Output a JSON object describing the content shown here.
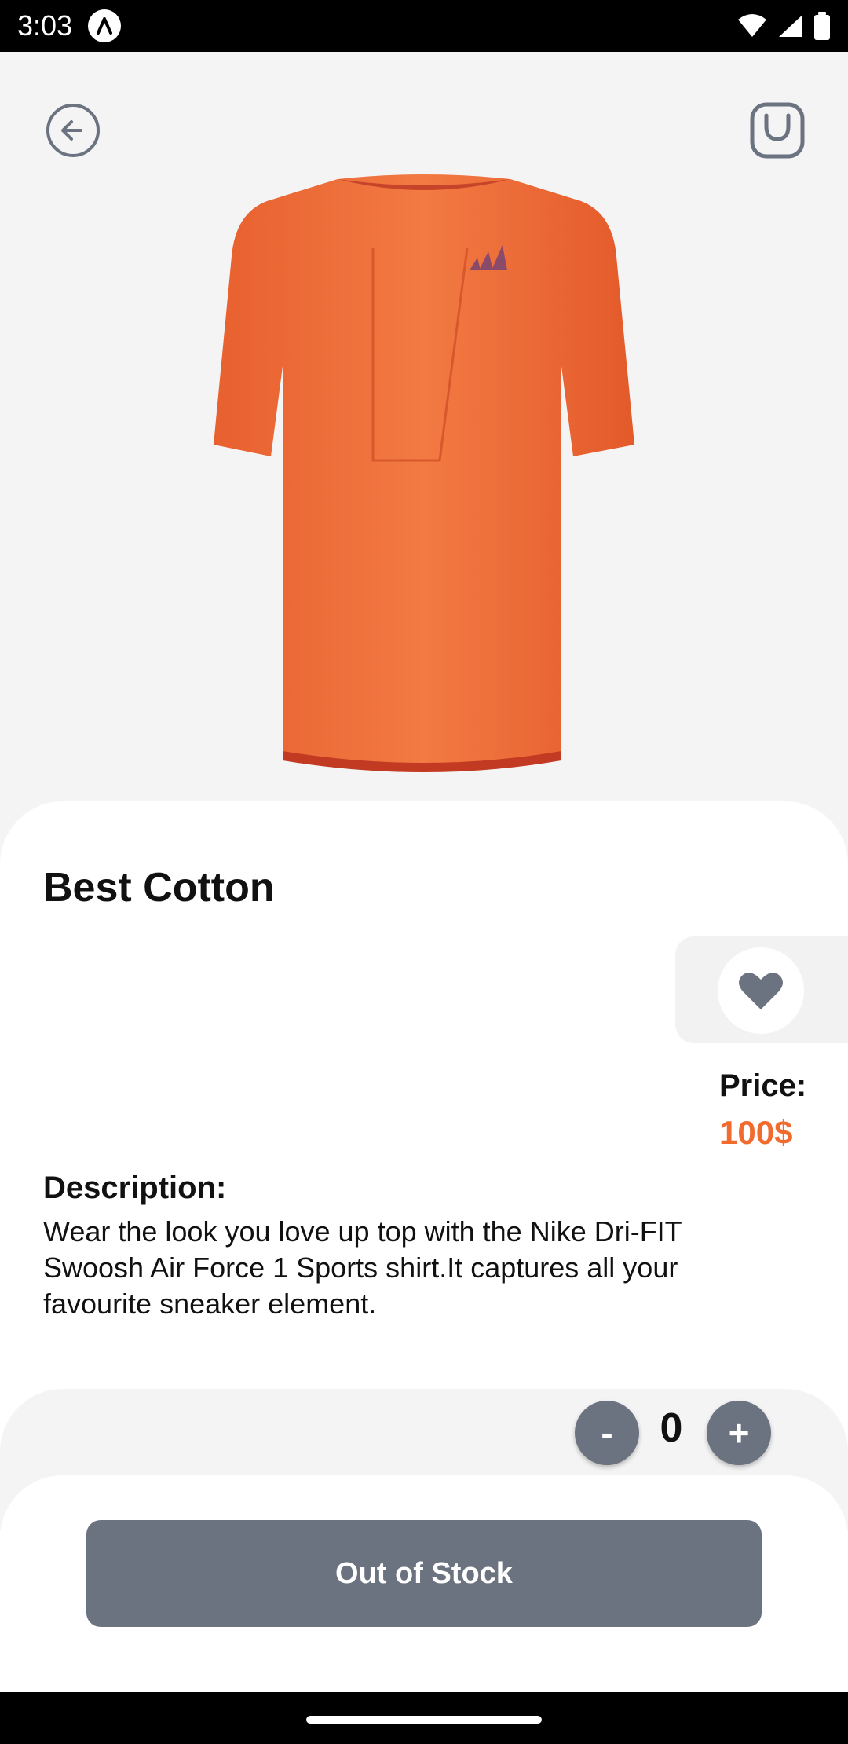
{
  "status_bar": {
    "time": "3:03"
  },
  "header": {
    "back_icon": "arrow-left-circle",
    "bag_icon": "shopping-bag"
  },
  "product": {
    "title": "Best Cotton",
    "image": "orange-tshirt",
    "price_label": "Price:",
    "price_value": "100$",
    "description_label": "Description:",
    "description": "Wear the look you love up top with the Nike Dri-FIT Swoosh Air Force 1 Sports shirt.It captures all your favourite sneaker element."
  },
  "favorite": {
    "icon": "heart"
  },
  "quantity": {
    "minus_label": "-",
    "value": "0",
    "plus_label": "+"
  },
  "cta": {
    "label": "Out of Stock"
  },
  "colors": {
    "accent": "#f26b2e",
    "button_gray": "#6b7280",
    "background": "#f4f4f4"
  }
}
